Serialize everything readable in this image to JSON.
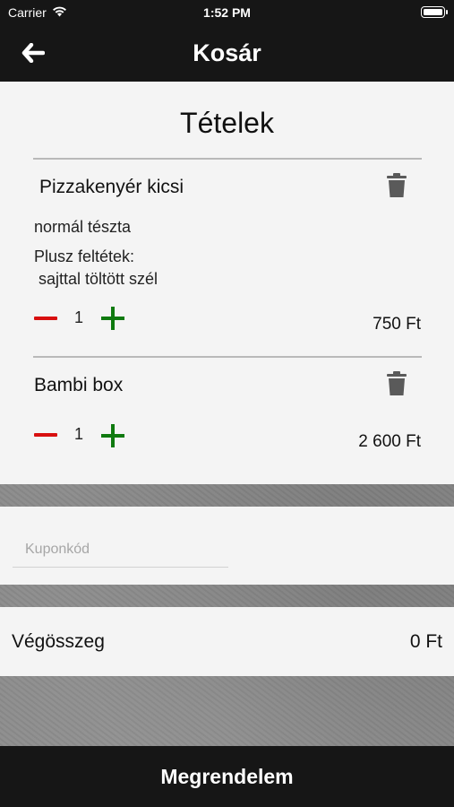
{
  "status_bar": {
    "carrier": "Carrier",
    "time": "1:52 PM",
    "battery_level": 1.0
  },
  "nav": {
    "title": "Kosár",
    "back_icon": "arrow-left-icon"
  },
  "cart": {
    "title": "Tételek",
    "items": [
      {
        "name": "Pizzakenyér kicsi",
        "details": [
          "normál tészta",
          "Plusz feltétek:",
          " sajttal töltött szél"
        ],
        "quantity": "1",
        "price": "750 Ft",
        "delete_icon": "trash-icon"
      },
      {
        "name": "Bambi box",
        "details": [],
        "quantity": "1",
        "price": "2 600 Ft",
        "delete_icon": "trash-icon"
      }
    ]
  },
  "coupon": {
    "placeholder": "Kuponkód",
    "value": ""
  },
  "total": {
    "label": "Végösszeg",
    "value": "0 Ft"
  },
  "order_button": {
    "label": "Megrendelem"
  },
  "colors": {
    "bar_background": "#161616",
    "card_background": "#f4f4f4",
    "minus": "#d80f0f",
    "plus": "#0f7a0f",
    "trash": "#5a5a5a"
  }
}
